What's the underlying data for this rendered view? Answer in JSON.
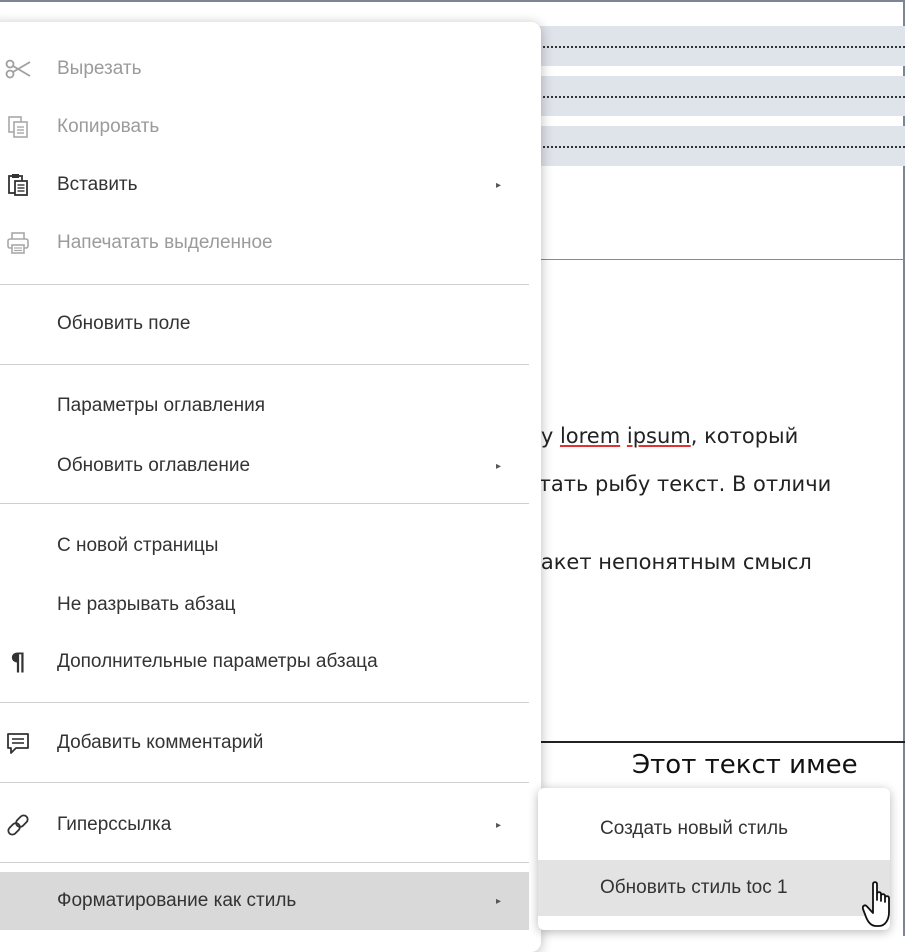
{
  "document": {
    "line1": "му ",
    "line1_word1": "lorem",
    "line1_space": " ",
    "line1_word2": "ipsum",
    "line1_rest": ", который",
    "line2": "итать рыбу текст. В отличи",
    "line3": "макет непонятным смысл",
    "heading": "Этот текст имее"
  },
  "context_menu": {
    "items": [
      {
        "label": "Вырезать",
        "icon": "scissors-icon",
        "enabled": false
      },
      {
        "label": "Копировать",
        "icon": "copy-icon",
        "enabled": false
      },
      {
        "label": "Вставить",
        "icon": "paste-icon",
        "enabled": true,
        "submenu": true
      },
      {
        "label": "Напечатать выделенное",
        "icon": "printer-icon",
        "enabled": false
      },
      {
        "label": "Обновить поле",
        "enabled": true
      },
      {
        "label": "Параметры оглавления",
        "enabled": true
      },
      {
        "label": "Обновить оглавление",
        "enabled": true,
        "submenu": true
      },
      {
        "label": "С новой страницы",
        "enabled": true
      },
      {
        "label": "Не разрывать абзац",
        "enabled": true
      },
      {
        "label": "Дополнительные параметры абзаца",
        "icon": "pilcrow-icon",
        "enabled": true
      },
      {
        "label": "Добавить комментарий",
        "icon": "comment-icon",
        "enabled": true
      },
      {
        "label": "Гиперссылка",
        "icon": "link-icon",
        "enabled": true,
        "submenu": true
      },
      {
        "label": "Форматирование как стиль",
        "enabled": true,
        "submenu": true,
        "highlighted": true
      }
    ]
  },
  "submenu": {
    "items": [
      {
        "label": "Создать новый стиль"
      },
      {
        "label": "Обновить стиль toc 1",
        "highlighted": true
      }
    ]
  },
  "icons": {
    "arrow": "▸",
    "pilcrow": "¶"
  },
  "colors": {
    "menu_highlight": "#d9d9d9",
    "submenu_highlight": "#e3e3e3",
    "toc_band": "#dfe3ea",
    "spell_underline": "#dd3333"
  }
}
